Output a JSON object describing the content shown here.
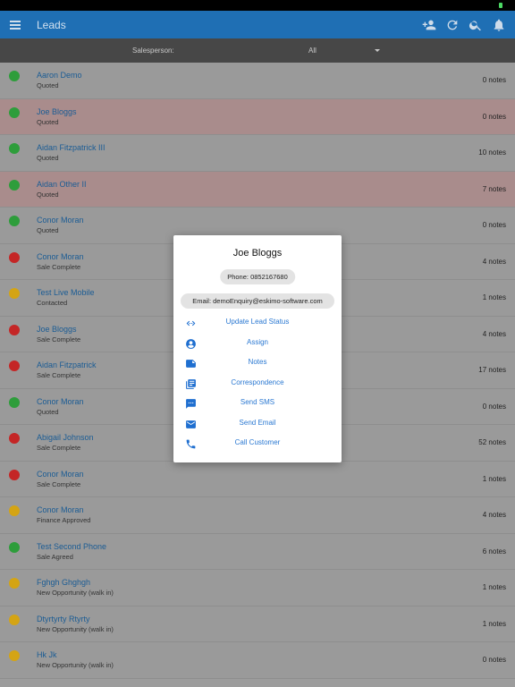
{
  "appbar": {
    "title": "Leads",
    "icons": [
      "menu-icon",
      "add-person-icon",
      "refresh-icon",
      "search-icon",
      "bell-icon"
    ]
  },
  "filter": {
    "label": "Salesperson:",
    "value": "All"
  },
  "colors": {
    "green": "#2e9d3b",
    "red": "#c42626",
    "yellow": "#d4a414"
  },
  "leads": [
    {
      "name": "Aaron Demo",
      "status": "Quoted",
      "notes": "0 notes",
      "dot": "green",
      "highlight": false
    },
    {
      "name": "Joe Bloggs",
      "status": "Quoted",
      "notes": "0 notes",
      "dot": "green",
      "highlight": true
    },
    {
      "name": "Aidan Fitzpatrick III",
      "status": "Quoted",
      "notes": "10 notes",
      "dot": "green",
      "highlight": false
    },
    {
      "name": "Aidan Other II",
      "status": "Quoted",
      "notes": "7 notes",
      "dot": "green",
      "highlight": true
    },
    {
      "name": "Conor Moran",
      "status": "Quoted",
      "notes": "0 notes",
      "dot": "green",
      "highlight": false
    },
    {
      "name": "Conor Moran",
      "status": "Sale Complete",
      "notes": "4 notes",
      "dot": "red",
      "highlight": false
    },
    {
      "name": "Test Live Mobile",
      "status": "Contacted",
      "notes": "1 notes",
      "dot": "yellow",
      "highlight": false
    },
    {
      "name": "Joe Bloggs",
      "status": "Sale Complete",
      "notes": "4 notes",
      "dot": "red",
      "highlight": false
    },
    {
      "name": "Aidan Fitzpatrick",
      "status": "Sale Complete",
      "notes": "17 notes",
      "dot": "red",
      "highlight": false
    },
    {
      "name": "Conor Moran",
      "status": "Quoted",
      "notes": "0 notes",
      "dot": "green",
      "highlight": false
    },
    {
      "name": "Abigail Johnson",
      "status": "Sale Complete",
      "notes": "52 notes",
      "dot": "red",
      "highlight": false
    },
    {
      "name": "Conor Moran",
      "status": "Sale Complete",
      "notes": "1 notes",
      "dot": "red",
      "highlight": false
    },
    {
      "name": "Conor Moran",
      "status": "Finance Approved",
      "notes": "4 notes",
      "dot": "yellow",
      "highlight": false
    },
    {
      "name": "Test Second Phone",
      "status": "Sale Agreed",
      "notes": "6 notes",
      "dot": "green",
      "highlight": false
    },
    {
      "name": "Fghgh Ghghgh",
      "status": "New Opportunity (walk in)",
      "notes": "1 notes",
      "dot": "yellow",
      "highlight": false
    },
    {
      "name": "Dtyrtyrty Rtyrty",
      "status": "New Opportunity (walk in)",
      "notes": "1 notes",
      "dot": "yellow",
      "highlight": false
    },
    {
      "name": "Hk Jk",
      "status": "New Opportunity (walk in)",
      "notes": "0 notes",
      "dot": "yellow",
      "highlight": false
    }
  ],
  "dialog": {
    "title": "Joe Bloggs",
    "phone": "Phone: 0852167680",
    "email": "Email: demoEnquiry@eskimo-software.com",
    "actions": [
      {
        "label": "Update Lead Status",
        "icon": "code-arrows-icon"
      },
      {
        "label": "Assign",
        "icon": "account-circle-icon"
      },
      {
        "label": "Notes",
        "icon": "note-icon"
      },
      {
        "label": "Correspondence",
        "icon": "library-books-icon"
      },
      {
        "label": "Send SMS",
        "icon": "sms-icon"
      },
      {
        "label": "Send Email",
        "icon": "email-icon"
      },
      {
        "label": "Call Customer",
        "icon": "phone-icon"
      }
    ]
  }
}
